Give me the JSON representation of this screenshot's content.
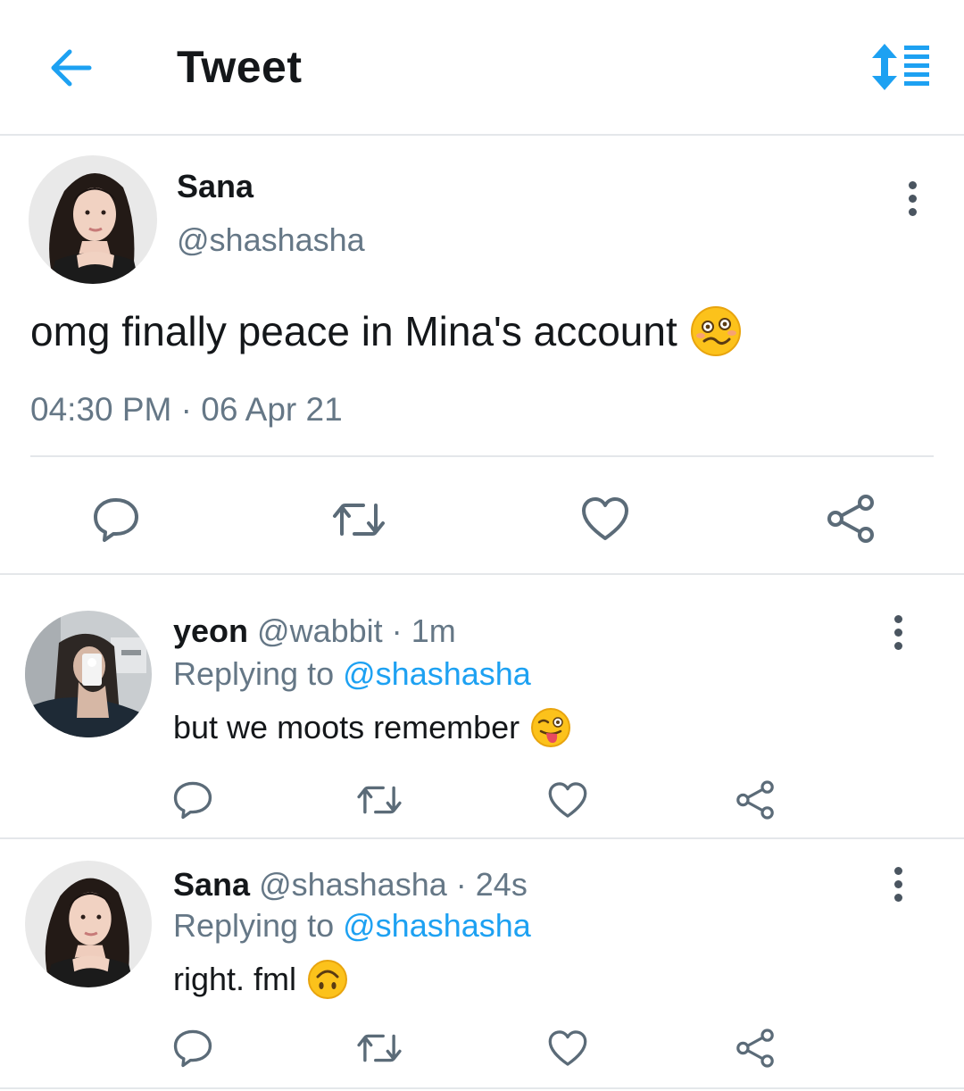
{
  "header": {
    "title": "Tweet",
    "back_icon": "arrow-left-icon",
    "sort_icon": "sort-list-icon",
    "accent": "#1da1f2"
  },
  "main_tweet": {
    "name": "Sana",
    "handle": "@shashasha",
    "text": "omg finally peace in Mina's account",
    "emoji": "woozy-face",
    "time": "04:30 PM",
    "separator": "·",
    "date": "06 Apr 21"
  },
  "replies": [
    {
      "name": "yeon",
      "handle": "@wabbit",
      "separator": "·",
      "time": "1m",
      "replying_prefix": "Replying to",
      "replying_handle": "@shashasha",
      "text": "but we moots remember",
      "emoji": "winking-face-with-tongue"
    },
    {
      "name": "Sana",
      "handle": "@shashasha",
      "separator": "·",
      "time": "24s",
      "replying_prefix": "Replying to",
      "replying_handle": "@shashasha",
      "text": "right. fml",
      "emoji": "upside-down-face"
    }
  ],
  "colors": {
    "text_primary": "#14171a",
    "text_secondary": "#657786",
    "link": "#1da1f2",
    "border": "#e4e7ea",
    "icon": "#5b6b78"
  }
}
